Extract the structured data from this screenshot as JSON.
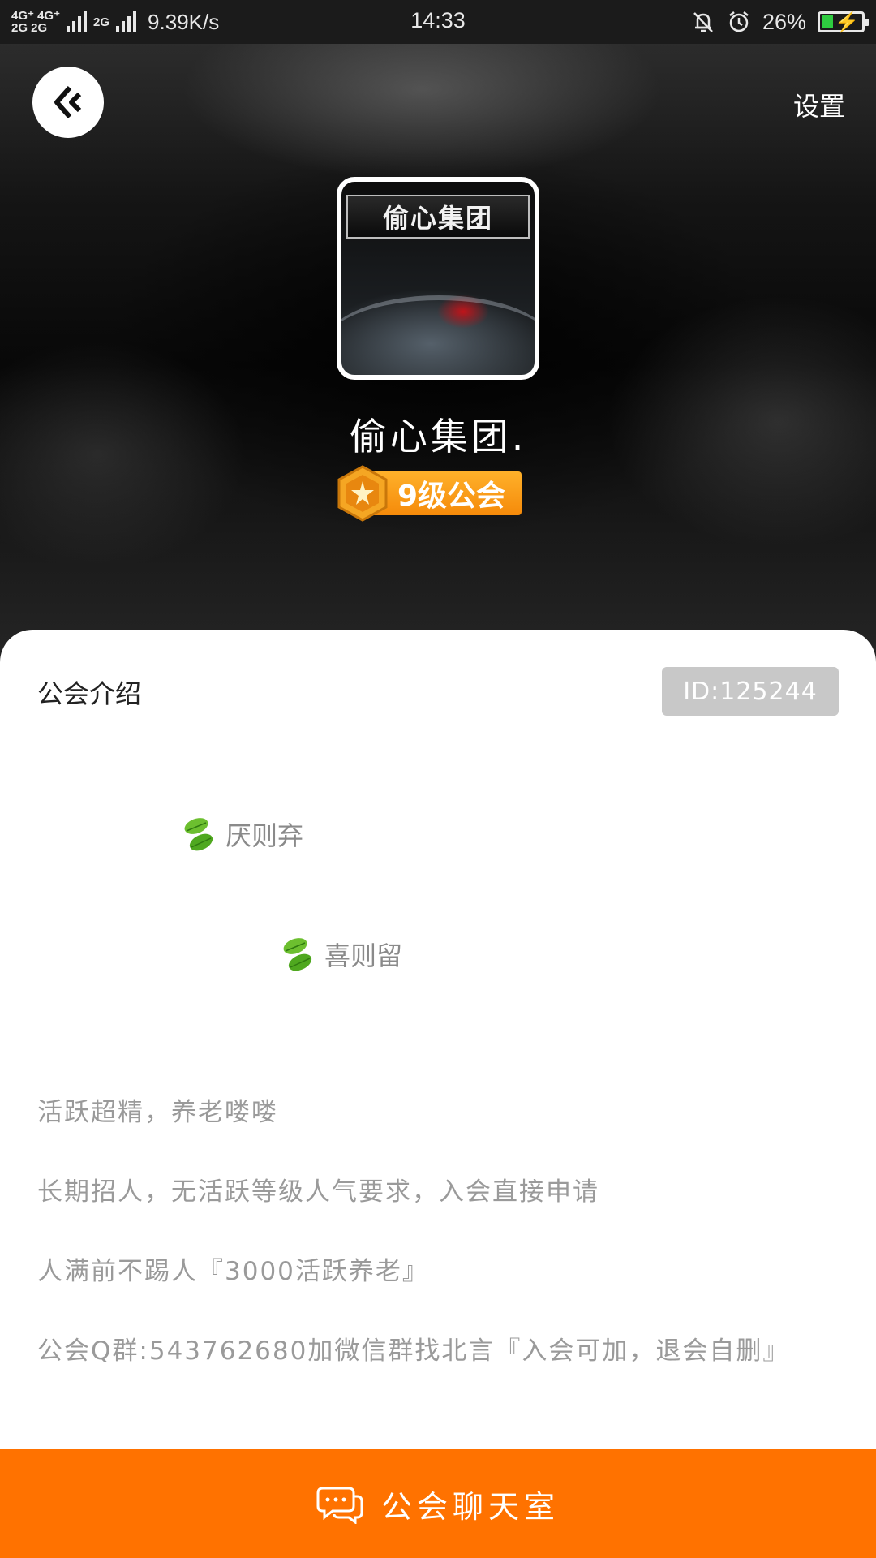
{
  "status_bar": {
    "network_top": "4G⁺ 4G⁺",
    "network_bottom": "2G 2G",
    "network_2g": "2G",
    "speed": "9.39K/s",
    "time": "14:33",
    "battery": "26%",
    "battery_level": 0.26
  },
  "header": {
    "settings_label": "设置"
  },
  "guild": {
    "avatar_plaque": "偷心集团",
    "name": "偷心集团.",
    "level_label": "9级公会"
  },
  "intro": {
    "title": "公会介绍",
    "id": "ID:125244",
    "line1": "厌则弃",
    "line2": "喜则留",
    "desc1": "活跃超精，养老喽喽",
    "desc2": "长期招人，无活跃等级人气要求，入会直接申请",
    "desc3": "人满前不踢人『3000活跃养老』",
    "desc4": "公会Q群:543762680加微信群找北言『入会可加，退会自删』"
  },
  "footer": {
    "chat_label": "公会聊天室"
  },
  "icons": {
    "back": "back-arrow-icon",
    "leaf": "leaf-icon",
    "chat": "chat-bubble-icon",
    "level": "star-hexagon-icon",
    "bell_muted": "bell-off-icon",
    "alarm": "alarm-icon"
  },
  "colors": {
    "accent": "#ff7200",
    "badge": "#f58a0a",
    "id_chip": "#c8c8c8"
  }
}
